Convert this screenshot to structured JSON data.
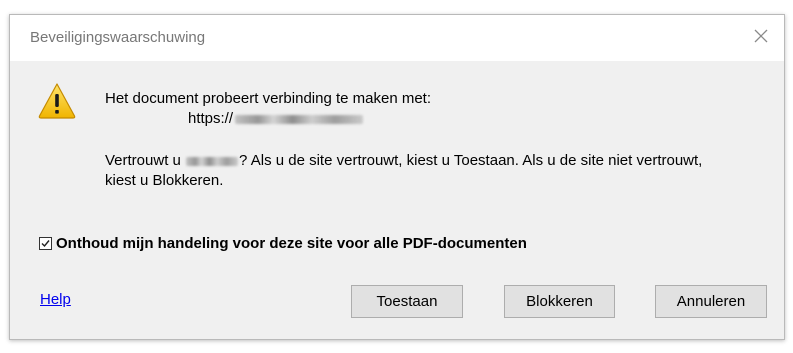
{
  "window": {
    "title": "Beveiligingswaarschuwing",
    "close_icon": "close-icon"
  },
  "message": {
    "icon": "warning-icon",
    "line1": "Het document probeert verbinding te maken met:",
    "url_prefix": "https://",
    "trust_prefix": "Vertrouwt u ",
    "trust_suffix": "? Als u de site vertrouwt, kiest u Toestaan. Als u de site niet vertrouwt, kiest u Blokkeren."
  },
  "remember": {
    "checked": true,
    "label": "Onthoud mijn handeling voor deze site voor alle PDF-documenten"
  },
  "footer": {
    "help_label": "Help",
    "allow_label": "Toestaan",
    "block_label": "Blokkeren",
    "cancel_label": "Annuleren"
  },
  "colors": {
    "link": "#0000ee",
    "dialog_bg": "#f0f0f0",
    "button_bg": "#e1e1e1",
    "warning_yellow": "#f5c518"
  }
}
